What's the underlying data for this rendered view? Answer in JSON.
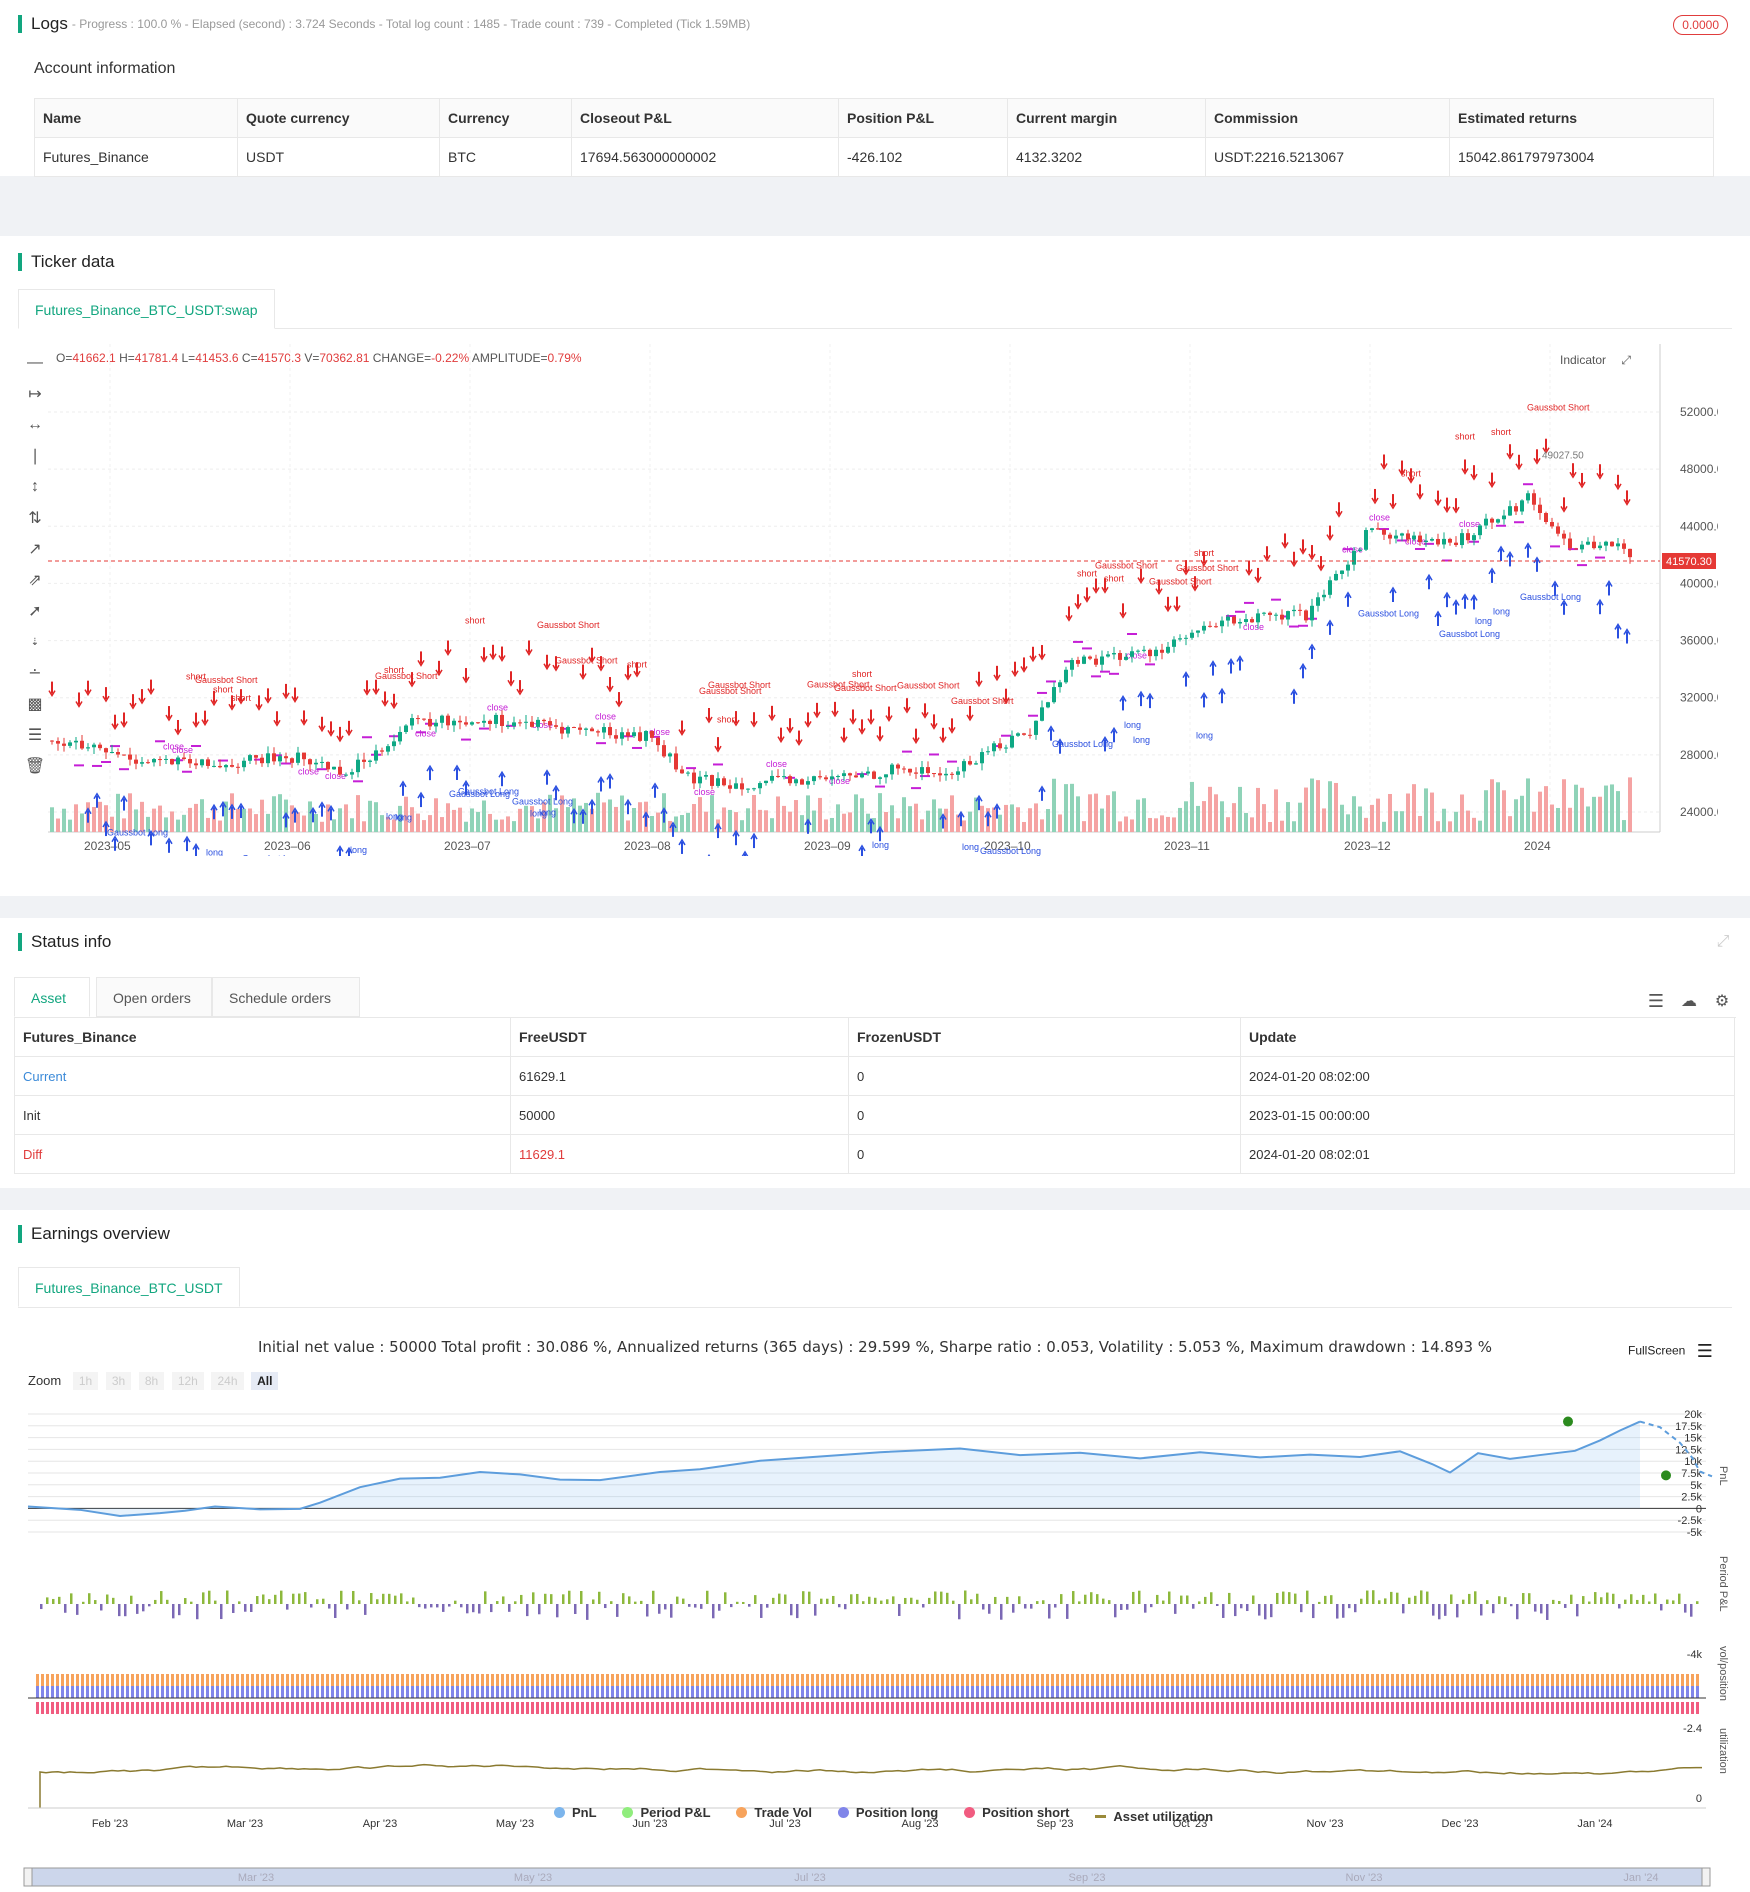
{
  "logs": {
    "title": "Logs",
    "status_line": "- Progress : 100.0 % - Elapsed (second) : 3.724  Seconds - Total log count : 1485 - Trade count : 739 - Completed (Tick 1.59MB)",
    "badge": "0.0000"
  },
  "account": {
    "title": "Account information",
    "headers": [
      "Name",
      "Quote currency",
      "Currency",
      "Closeout P&L",
      "Position P&L",
      "Current margin",
      "Commission",
      "Estimated returns"
    ],
    "row": [
      "Futures_Binance",
      "USDT",
      "BTC",
      "17694.563000000002",
      "-426.102",
      "4132.3202",
      "USDT:2216.5213067",
      "15042.861797973004"
    ]
  },
  "ticker": {
    "title": "Ticker data",
    "tab": "Futures_Binance_BTC_USDT:swap",
    "ohlc": {
      "o_label": "O=",
      "o": "41662.1",
      "h_label": "H=",
      "h": "41781.4",
      "l_label": "L=",
      "l": "41453.6",
      "c_label": "C=",
      "c": "41570.3",
      "v_label": "V=",
      "v": "70362.81",
      "change_label": "CHANGE=",
      "change": "-0.22%",
      "amp_label": "AMPLITUDE=",
      "amp": "0.79%"
    },
    "indicator_label": "Indicator",
    "last_price": "41570.30",
    "high_marker": "49027.50",
    "y_ticks": [
      "52000.00",
      "48000.00",
      "44000.00",
      "40000.00",
      "36000.00",
      "32000.00",
      "28000.00",
      "24000.00"
    ],
    "x_ticks": [
      "2023–05",
      "2023–06",
      "2023–07",
      "2023–08",
      "2023–09",
      "2023–10",
      "2023–11",
      "2023–12",
      "2024"
    ],
    "annotations": {
      "short": "short",
      "long": "long",
      "close": "close",
      "gauss_short": "Gaussbot Short",
      "gauss_long": "Gaussbot Long"
    }
  },
  "status": {
    "title": "Status info",
    "tabs": [
      "Asset",
      "Open orders",
      "Schedule orders"
    ],
    "headers": [
      "Futures_Binance",
      "FreeUSDT",
      "FrozenUSDT",
      "Update"
    ],
    "rows": [
      [
        "Current",
        "61629.1",
        "0",
        "2024-01-20 08:02:00"
      ],
      [
        "Init",
        "50000",
        "0",
        "2023-01-15 00:00:00"
      ],
      [
        "Diff",
        "11629.1",
        "0",
        "2024-01-20 08:02:01"
      ]
    ],
    "colors": {
      "current": "#3b8ad8",
      "diff": "#e03c3c"
    }
  },
  "earnings": {
    "title": "Earnings overview",
    "tab": "Futures_Binance_BTC_USDT",
    "summary": "Initial net value : 50000 Total profit : 30.086 %, Annualized returns (365 days) : 29.599 %, Sharpe ratio : 0.053, Volatility : 5.053 %, Maximum drawdown : 14.893 %",
    "fullscreen": "FullScreen",
    "zoom_label": "Zoom",
    "zoom_buttons": [
      "1h",
      "3h",
      "8h",
      "12h",
      "24h",
      "All"
    ],
    "pnl_ticks": [
      "20k",
      "17.5k",
      "15k",
      "12.5k",
      "10k",
      "7.5k",
      "5k",
      "2.5k",
      "0",
      "-2.5k",
      "-5k"
    ],
    "period_ticks": [
      "-4k"
    ],
    "vol_ticks": [
      "-2.4"
    ],
    "util_ticks": [
      "0"
    ],
    "axis_labels": [
      "PnL",
      "Period P&L",
      "vol/position",
      "utilization"
    ],
    "x_ticks": [
      "Feb '23",
      "Mar '23",
      "Apr '23",
      "May '23",
      "Jun '23",
      "Jul '23",
      "Aug '23",
      "Sep '23",
      "Oct '23",
      "Nov '23",
      "Dec '23",
      "Jan '24"
    ],
    "nav_ticks": [
      "Mar '23",
      "May '23",
      "Jul '23",
      "Sep '23",
      "Nov '23",
      "Jan '24"
    ],
    "legend": [
      {
        "label": "PnL",
        "color": "#7cb5ec"
      },
      {
        "label": "Period P&L",
        "color": "#90ed7d"
      },
      {
        "label": "Trade Vol",
        "color": "#f7a35c"
      },
      {
        "label": "Position long",
        "color": "#8085e9"
      },
      {
        "label": "Position short",
        "color": "#f15c80"
      },
      {
        "label": "Asset utilization",
        "color": "#9a8a3a"
      }
    ]
  }
}
